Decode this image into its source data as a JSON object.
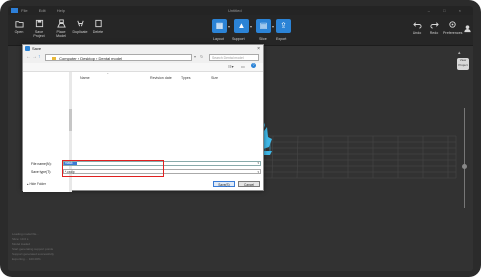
{
  "titlebar": {
    "menu": [
      "File",
      "Edit",
      "Help"
    ],
    "title": "Untitled",
    "window_buttons": [
      "–",
      "□",
      "×"
    ]
  },
  "toolbar": {
    "left_buttons": [
      {
        "label": "Open",
        "icon": "folder-open-icon"
      },
      {
        "label": "Save Project",
        "icon": "save-project-icon"
      },
      {
        "label": "Place Model",
        "icon": "place-model-icon"
      },
      {
        "label": "Duplicate",
        "icon": "duplicate-icon"
      },
      {
        "label": "Delete",
        "icon": "delete-icon"
      }
    ],
    "center_buttons": [
      {
        "label": "Layout",
        "icon": "layout-icon"
      },
      {
        "label": "Support",
        "icon": "support-icon"
      },
      {
        "label": "Slice",
        "icon": "slice-icon"
      },
      {
        "label": "Export",
        "icon": "export-icon"
      }
    ],
    "right_buttons": [
      {
        "label": "Undo",
        "icon": "undo-icon"
      },
      {
        "label": "Redo",
        "icon": "redo-icon"
      },
      {
        "label": "Preferences",
        "icon": "preferences-icon"
      },
      {
        "label": "",
        "icon": "user-icon"
      }
    ],
    "accent_color": "#2b83d6"
  },
  "dialog": {
    "title": "Save",
    "breadcrumb": [
      "Computer",
      "Desktop",
      "Dental model"
    ],
    "search_placeholder": "Search Dental model",
    "columns": [
      "Name",
      "Revision date",
      "Types",
      "Size"
    ],
    "file_name_label": "File name(N):",
    "file_name_value": "mask",
    "save_type_label": "Save type(T):",
    "save_type_value": "*.cxdlp",
    "hide_folders_label": "Hide Folder",
    "save_button": "Save(S)",
    "cancel_button": "Cancel"
  },
  "right_panel": {
    "view_label": "View",
    "project_label": "Project"
  },
  "log_lines": [
    "Loading model file...",
    "Slice: 10.0 s",
    "Model loaded",
    "Start generating support points",
    "Support generated successfully",
    "Exporting ... 100.00%"
  ]
}
